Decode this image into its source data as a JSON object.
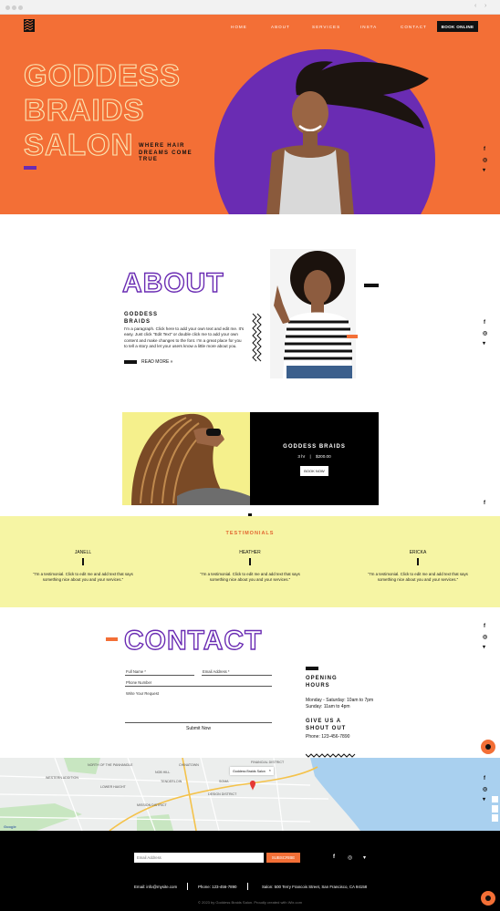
{
  "nav": {
    "logo_icon": "zigzag-logo-icon",
    "links": [
      "HOME",
      "ABOUT",
      "SERVICES",
      "INSTA",
      "CONTACT"
    ],
    "book_online": "BOOK ONLINE"
  },
  "hero": {
    "line1": "GODDESS",
    "line2": "BRAIDS",
    "line3": "SALON",
    "tagline": "WHERE HAIR DREAMS COME TRUE"
  },
  "social": {
    "icons": [
      "facebook-icon",
      "instagram-icon",
      "twitter-icon"
    ],
    "glyphs": [
      "f",
      "◎",
      "▾"
    ]
  },
  "about": {
    "title": "ABOUT",
    "subtitle": "GODDESS BRAIDS",
    "paragraph": "I'm a paragraph. Click here to add your own text and edit me. It's easy. Just click \"Edit Text\" or double click me to add your own content and make changes to the font. I'm a great place for you to tell a story and let your users know a little more about you.",
    "read_more": "READ MORE »"
  },
  "booking": {
    "title": "GODDESS BRAIDS",
    "duration": "3 hr",
    "price": "$200.00",
    "button": "BOOK NOW"
  },
  "testimonials": {
    "title": "TESTIMONIALS",
    "items": [
      {
        "name": "JANELL",
        "quote": "\"I'm a testimonial. Click to edit me and add text that says something nice about you and your services.\""
      },
      {
        "name": "HEATHER",
        "quote": "\"I'm a testimonial. Click to edit me and add text that says something nice about you and your services.\""
      },
      {
        "name": "ERICKA",
        "quote": "\"I'm a testimonial. Click to edit me and add text that says something nice about you and your services.\""
      }
    ]
  },
  "contact": {
    "title": "CONTACT",
    "full_name": "Full Name *",
    "email": "Email Address *",
    "phone": "Phone Number",
    "request": "Write Your Request",
    "submit": "Submit Now",
    "opening_hours_title": "OPENING HOURS",
    "hours_line1": "Monday - Saturday: 10am to 7pm",
    "hours_line2": "Sunday: 11am to 4pm",
    "shout_title": "GIVE US A SHOUT OUT",
    "phone_text": "Phone: 123-456-7890"
  },
  "map": {
    "popup": "Goddess Braids Salon",
    "labels": [
      "WESTERN ADDITION",
      "NORTH OF THE PANHANDLE",
      "LOWER HAIGHT",
      "MISSION DISTRICT",
      "DESIGN DISTRICT",
      "SOMA",
      "FINANCIAL DISTRICT",
      "CHINATOWN",
      "NOB HILL",
      "TENDERLOIN"
    ],
    "credit": "Google"
  },
  "footer": {
    "email_placeholder": "Email Address",
    "subscribe": "SUBSCRIBE",
    "email_info": "Email: info@mysite.com",
    "phone_info": "Phone: 123-456-7890",
    "address_info": "Salon: 500 Terry Francois Street, San Francisco, CA 94158",
    "copyright": "© 2023 by Goddess Braids Salon. Proudly created with Wix.com"
  },
  "colors": {
    "orange": "#f36f36",
    "purple": "#6a2cb3",
    "yellow": "#f6f5a4",
    "cream": "#fbe7b5"
  }
}
